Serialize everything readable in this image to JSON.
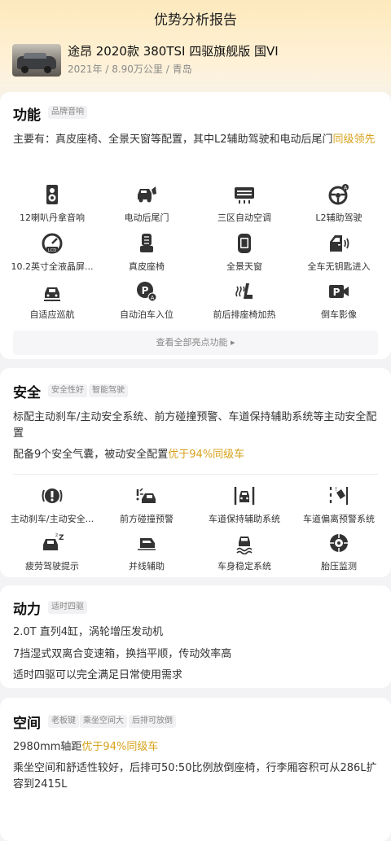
{
  "header": {
    "title": "优势分析报告",
    "car_name": "途昂 2020款 380TSI 四驱旗舰版 国VI",
    "car_meta": "2021年 / 8.90万公里 / 青岛"
  },
  "function": {
    "title": "功能",
    "tags": [
      "品牌音响"
    ],
    "summary_prefix": "主要有：真皮座椅、全景天窗等配置，其中L2辅助驾驶和电动后尾门",
    "summary_hl": "同级领先",
    "items": [
      {
        "label": "12喇叭丹拿音响",
        "icon": "speaker-icon"
      },
      {
        "label": "电动后尾门",
        "icon": "power-tailgate-icon"
      },
      {
        "label": "三区自动空调",
        "icon": "climate-control-icon"
      },
      {
        "label": "L2辅助驾驶",
        "icon": "steering-assist-icon"
      },
      {
        "label": "10.2英寸全液晶屏...",
        "icon": "lcd-gauge-icon"
      },
      {
        "label": "真皮座椅",
        "icon": "leather-seat-icon"
      },
      {
        "label": "全景天窗",
        "icon": "panoramic-sunroof-icon"
      },
      {
        "label": "全车无钥匙进入",
        "icon": "keyless-entry-icon"
      },
      {
        "label": "自适应巡航",
        "icon": "adaptive-cruise-icon"
      },
      {
        "label": "自动泊车入位",
        "icon": "auto-parking-icon"
      },
      {
        "label": "前后排座椅加热",
        "icon": "seat-heating-icon"
      },
      {
        "label": "倒车影像",
        "icon": "reverse-camera-icon"
      }
    ],
    "view_all": "查看全部亮点功能 ▸"
  },
  "safety": {
    "title": "安全",
    "tags": [
      "安全性好",
      "智能驾驶"
    ],
    "line1": "标配主动刹车/主动安全系统、前方碰撞预警、车道保持辅助系统等主动安全配置",
    "line2_prefix": "配备9个安全气囊，被动安全配置",
    "line2_hl": "优于94%同级车",
    "items": [
      {
        "label": "主动刹车/主动安全...",
        "icon": "active-brake-icon"
      },
      {
        "label": "前方碰撞预警",
        "icon": "collision-warning-icon"
      },
      {
        "label": "车道保持辅助系统",
        "icon": "lane-keep-icon"
      },
      {
        "label": "车道偏离预警系统",
        "icon": "lane-departure-icon"
      },
      {
        "label": "疲劳驾驶提示",
        "icon": "fatigue-alert-icon"
      },
      {
        "label": "并线辅助",
        "icon": "blind-spot-icon"
      },
      {
        "label": "车身稳定系统",
        "icon": "stability-control-icon"
      },
      {
        "label": "胎压监测",
        "icon": "tire-pressure-icon"
      }
    ]
  },
  "power": {
    "title": "动力",
    "tags": [
      "适时四驱"
    ],
    "lines": [
      "2.0T 直列4缸，涡轮增压发动机",
      "7挡湿式双离合变速箱，换挡平顺，传动效率高",
      "适时四驱可以完全满足日常使用需求"
    ]
  },
  "space": {
    "title": "空间",
    "tags": [
      "老板键",
      "乘坐空间大",
      "后排可放倒"
    ],
    "line1_prefix": "2980mm轴距",
    "line1_hl": "优于94%同级车",
    "line2": "乘坐空间和舒适性较好，后排可50:50比例放倒座椅，行李厢容积可从286L扩容到2415L"
  },
  "colors": {
    "highlight": "#d7a21c",
    "header_bg": "#fde9bd"
  }
}
